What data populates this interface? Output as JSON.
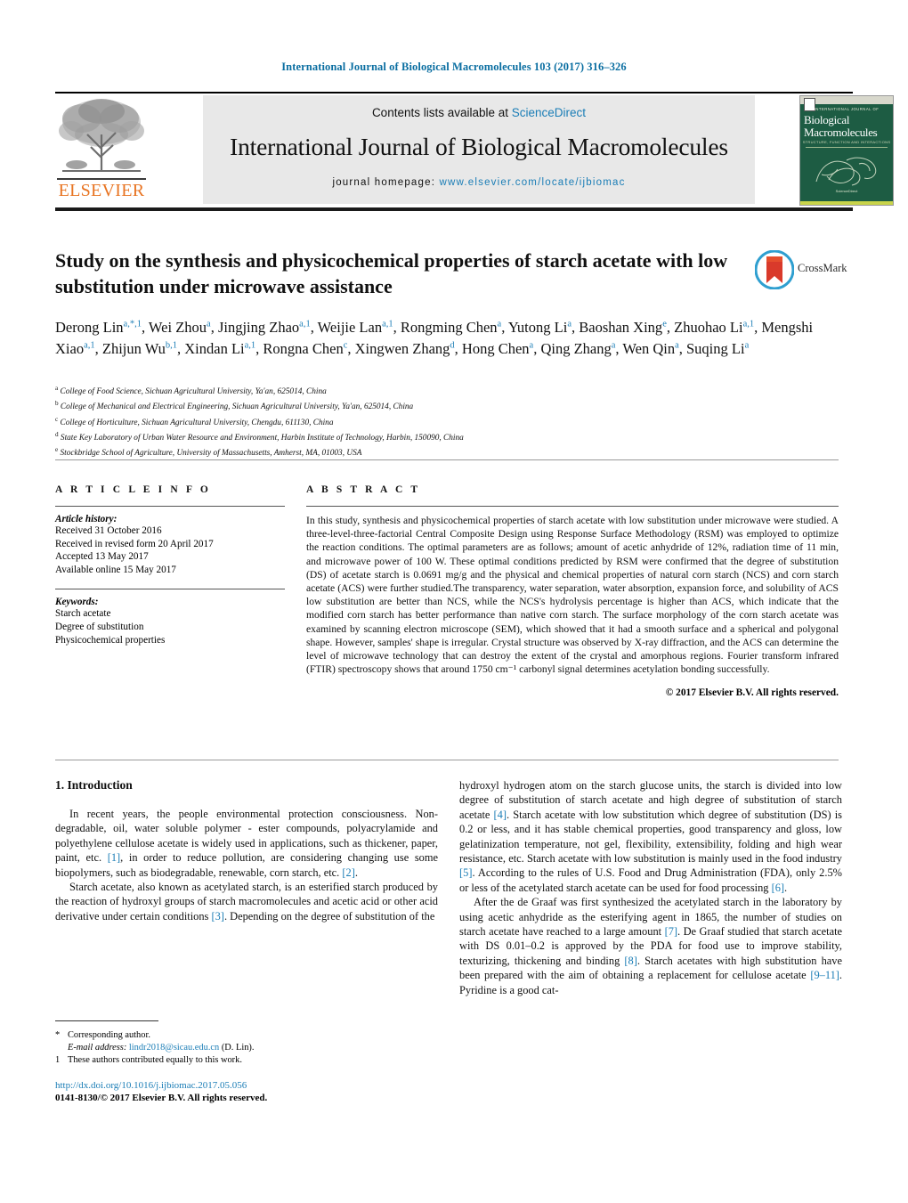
{
  "running_head": "International Journal of Biological Macromolecules 103 (2017) 316–326",
  "masthead": {
    "contents_prefix": "Contents lists available at ",
    "sciencedirect": "ScienceDirect",
    "journal_title": "International Journal of Biological Macromolecules",
    "homepage_prefix": "journal homepage: ",
    "homepage_url": "www.elsevier.com/locate/ijbiomac",
    "publisher_wordmark": "ELSEVIER",
    "cover": {
      "kicker": "INTERNATIONAL JOURNAL OF",
      "title_line1": "Biological",
      "title_line2": "Macromolecules",
      "subtitle": "STRUCTURE, FUNCTION AND INTERACTIONS",
      "footer": "ScienceDirect"
    }
  },
  "article": {
    "title": "Study on the synthesis and physicochemical properties of starch acetate with low substitution under microwave assistance",
    "crossmark_label": "CrossMark",
    "authors_html": "Derong Lin<sup>a,*,1</sup>, Wei Zhou<sup>a</sup>, Jingjing Zhao<sup>a,1</sup>, Weijie Lan<sup>a,1</sup>, Rongming Chen<sup>a</sup>, Yutong Li<sup>a</sup>, Baoshan Xing<sup>e</sup>, Zhuohao Li<sup>a,1</sup>, Mengshi Xiao<sup>a,1</sup>, Zhijun Wu<sup>b,1</sup>, Xindan Li<sup>a,1</sup>, Rongna Chen<sup>c</sup>, Xingwen Zhang<sup>d</sup>, Hong Chen<sup>a</sup>, Qing Zhang<sup>a</sup>, Wen Qin<sup>a</sup>, Suqing Li<sup>a</sup>",
    "affiliations": [
      {
        "mark": "a",
        "text": "College of Food Science, Sichuan Agricultural University, Ya'an, 625014, China"
      },
      {
        "mark": "b",
        "text": "College of Mechanical and Electrical Engineering, Sichuan Agricultural University, Ya'an, 625014, China"
      },
      {
        "mark": "c",
        "text": "College of Horticulture, Sichuan Agricultural University, Chengdu, 611130, China"
      },
      {
        "mark": "d",
        "text": "State Key Laboratory of Urban Water Resource and Environment, Harbin Institute of Technology, Harbin, 150090, China"
      },
      {
        "mark": "e",
        "text": "Stockbridge School of Agriculture, University of Massachusetts, Amherst, MA, 01003, USA"
      }
    ]
  },
  "article_info": {
    "heading": "A R T I C L E   I N F O",
    "history_label": "Article history:",
    "history": [
      "Received 31 October 2016",
      "Received in revised form 20 April 2017",
      "Accepted 13 May 2017",
      "Available online 15 May 2017"
    ],
    "keywords_label": "Keywords:",
    "keywords": [
      "Starch acetate",
      "Degree of substitution",
      "Physicochemical properties"
    ]
  },
  "abstract": {
    "heading": "A B S T R A C T",
    "text": "In this study, synthesis and physicochemical properties of starch acetate with low substitution under microwave were studied. A three-level-three-factorial Central Composite Design using Response Surface Methodology (RSM) was employed to optimize the reaction conditions. The optimal parameters are as follows; amount of acetic anhydride of 12%, radiation time of 11 min, and microwave power of 100 W. These optimal conditions predicted by RSM were confirmed that the degree of substitution (DS) of acetate starch is 0.0691 mg/g and the physical and chemical properties of natural corn starch (NCS) and corn starch acetate (ACS) were further studied.The transparency, water separation, water absorption, expansion force, and solubility of ACS low substitution are better than NCS, while the NCS's hydrolysis percentage is higher than ACS, which indicate that the modified corn starch has better performance than native corn starch. The surface morphology of the corn starch acetate was examined by scanning electron microscope (SEM), which showed that it had a smooth surface and a spherical and polygonal shape. However, samples' shape is irregular. Crystal structure was observed by X-ray diffraction, and the ACS can determine the level of microwave technology that can destroy the extent of the crystal and amorphous regions. Fourier transform infrared (FTIR) spectroscopy shows that around 1750 cm⁻¹ carbonyl signal determines acetylation bonding successfully.",
    "copyright": "© 2017 Elsevier B.V. All rights reserved."
  },
  "introduction": {
    "heading": "1.  Introduction",
    "left_paragraph_1_html": "In recent years, the people environmental protection consciousness. Non-degradable, oil, water soluble polymer - ester compounds, polyacrylamide and polyethylene cellulose acetate is widely used in applications, such as thickener, paper, paint, etc. <span class=\"cite\">[1]</span>, in order to reduce pollution, are considering changing use some biopolymers, such as biodegradable, renewable, corn starch, etc. <span class=\"cite\">[2]</span>.",
    "left_paragraph_2_html": "Starch acetate, also known as acetylated starch, is an esterified starch produced by the reaction of hydroxyl groups of starch macromolecules and acetic acid or other acid derivative under certain conditions <span class=\"cite\">[3]</span>. Depending on the degree of substitution of the",
    "right_paragraph_1_html": "hydroxyl hydrogen atom on the starch glucose units, the starch is divided into low degree of substitution of starch acetate and high degree of substitution of starch acetate <span class=\"cite\">[4]</span>. Starch acetate with low substitution which degree of substitution (DS) is 0.2 or less, and it has stable chemical properties, good transparency and gloss, low gelatinization temperature, not gel, flexibility, extensibility, folding and high wear resistance, etc. Starch acetate with low substitution is mainly used in the food industry <span class=\"cite\">[5]</span>. According to the rules of U.S. Food and Drug Administration (FDA), only 2.5% or less of the acetylated starch acetate can be used for food processing <span class=\"cite\">[6]</span>.",
    "right_paragraph_2_html": "After the de Graaf was first synthesized the acetylated starch in the laboratory by using acetic anhydride as the esterifying agent in 1865, the number of studies on starch acetate have reached to a large amount <span class=\"cite\">[7]</span>. De Graaf studied that starch acetate with DS 0.01–0.2 is approved by the PDA for food use to improve stability, texturizing, thickening and binding <span class=\"cite\">[8]</span>. Starch acetates with high substitution have been prepared with the aim of obtaining a replacement for cellulose acetate <span class=\"cite\">[9–11]</span>. Pyridine is a good cat-"
  },
  "footnotes": {
    "corresponding_mark": "*",
    "corresponding_text": "Corresponding author.",
    "email_label": "E-mail address:",
    "email": "lindr2018@sicau.edu.cn",
    "email_suffix": "(D. Lin).",
    "equal_mark": "1",
    "equal_text": "These authors contributed equally to this work."
  },
  "footer": {
    "doi": "http://dx.doi.org/10.1016/j.ijbiomac.2017.05.056",
    "issn_line": "0141-8130/© 2017 Elsevier B.V. All rights reserved."
  },
  "colors": {
    "link": "#1a7db6",
    "elsevier_orange": "#e87422",
    "cover_green": "#1d5c43"
  }
}
